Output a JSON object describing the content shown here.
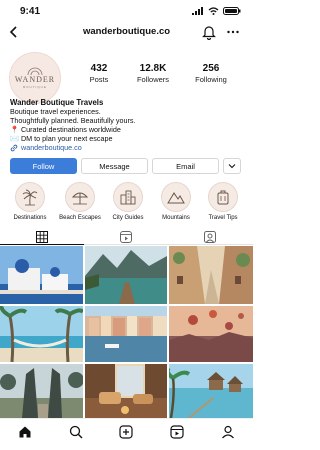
{
  "status": {
    "time": "9:41"
  },
  "header": {
    "username": "wanderboutique.co"
  },
  "profile": {
    "avatar_logo": "WANDER",
    "avatar_sub": "BOUTIQUE",
    "stats": [
      {
        "value": "432",
        "label": "Posts"
      },
      {
        "value": "12.8K",
        "label": "Followers"
      },
      {
        "value": "256",
        "label": "Following"
      }
    ]
  },
  "bio": {
    "name": "Wander Boutique Travels",
    "lines": [
      "Boutique travel experiences.",
      "Thoughtfully planned. Beautifully yours.",
      "📍 Curated destinations worldwide",
      "✉️ DM to plan your next escape"
    ],
    "link": "wanderboutique.co"
  },
  "actions": {
    "follow": "Follow",
    "message": "Message",
    "email": "Email"
  },
  "highlights": [
    {
      "label": "Destinations",
      "icon": "palm-tree-icon"
    },
    {
      "label": "Beach Escapes",
      "icon": "umbrella-icon"
    },
    {
      "label": "City Guides",
      "icon": "buildings-icon"
    },
    {
      "label": "Mountains",
      "icon": "mountains-icon"
    },
    {
      "label": "Travel Tips",
      "icon": "suitcase-icon"
    }
  ],
  "tabs": [
    "grid-icon",
    "reels-icon",
    "tagged-icon"
  ],
  "grid": [
    {
      "name": "santorini-photo",
      "colors": [
        "#6fa8dc",
        "#e9f0f6",
        "#2a62a8"
      ]
    },
    {
      "name": "lake-dock-photo",
      "colors": [
        "#3f6f6a",
        "#7fb7b0",
        "#4a5a3d"
      ]
    },
    {
      "name": "village-street-photo",
      "colors": [
        "#c9a074",
        "#d8c4a8",
        "#6b8a52"
      ]
    },
    {
      "name": "hammock-beach-photo",
      "colors": [
        "#7fc3df",
        "#e8dcc3",
        "#3f7a4a"
      ]
    },
    {
      "name": "harbor-town-photo",
      "colors": [
        "#9cc4dc",
        "#d9b79c",
        "#4f86a8"
      ]
    },
    {
      "name": "balloons-photo",
      "colors": [
        "#b57d6a",
        "#e3b48e",
        "#8a5a58"
      ]
    },
    {
      "name": "temple-gate-photo",
      "colors": [
        "#b9c7c9",
        "#7d8a6f",
        "#4b5f55"
      ]
    },
    {
      "name": "cozy-lodge-photo",
      "colors": [
        "#8a5c3c",
        "#d8a46a",
        "#3e2c22"
      ]
    },
    {
      "name": "overwater-villas-photo",
      "colors": [
        "#5fb7cf",
        "#b5dfe8",
        "#3a8a4f"
      ]
    }
  ]
}
